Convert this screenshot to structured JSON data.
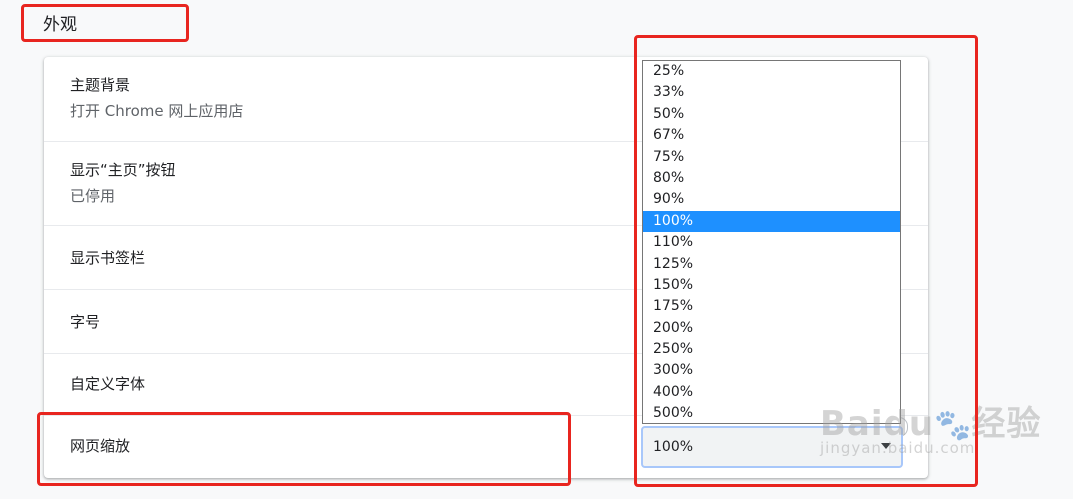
{
  "section": {
    "title": "外观"
  },
  "rows": {
    "theme": {
      "label": "主题背景",
      "sub": "打开 Chrome 网上应用店"
    },
    "home": {
      "label": "显示“主页”按钮",
      "sub": "已停用"
    },
    "bookmarks": {
      "label": "显示书签栏"
    },
    "font_size": {
      "label": "字号"
    },
    "custom_fonts": {
      "label": "自定义字体"
    },
    "zoom": {
      "label": "网页缩放"
    }
  },
  "zoom_select": {
    "value": "100%",
    "selected_index": 7,
    "options": [
      "25%",
      "33%",
      "50%",
      "67%",
      "75%",
      "80%",
      "90%",
      "100%",
      "110%",
      "125%",
      "150%",
      "175%",
      "200%",
      "250%",
      "300%",
      "400%",
      "500%"
    ]
  },
  "watermark": {
    "brand": "Baidu",
    "paw": "🐾",
    "cn": "经验",
    "url": "jingyan.baidu.com"
  },
  "colors": {
    "annotation": "#e8251f",
    "highlight": "#1e90ff",
    "focus_ring": "#a8c7fa"
  }
}
